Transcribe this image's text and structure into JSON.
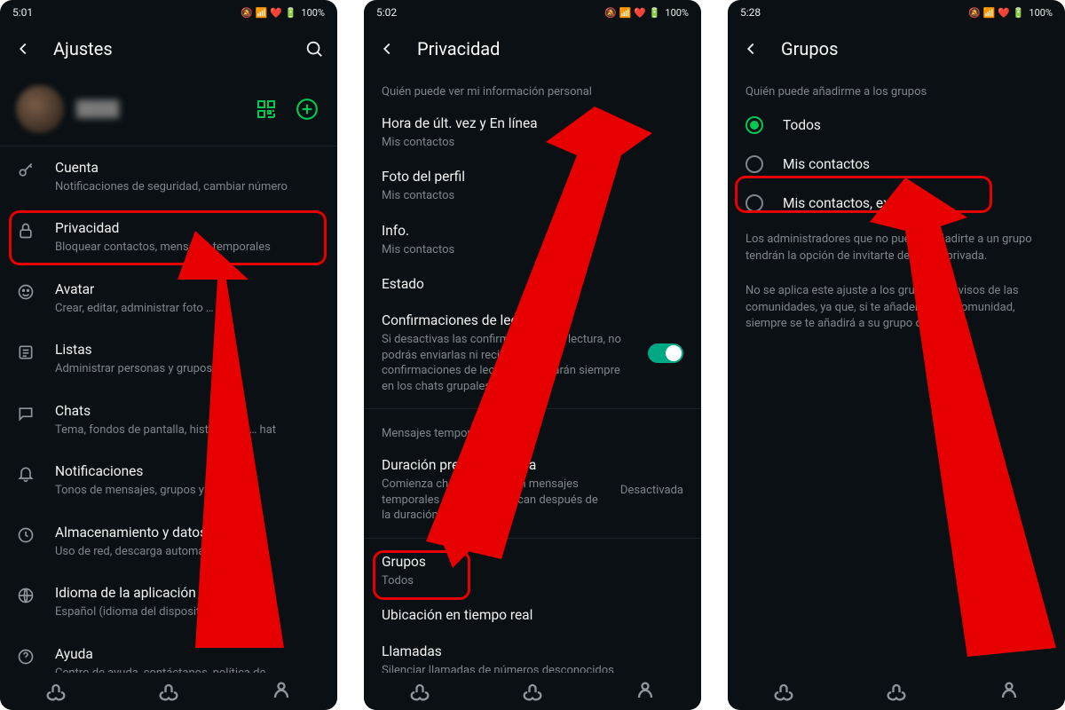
{
  "status": {
    "times": [
      "5:01",
      "5:02",
      "5:28"
    ],
    "battery": "100%",
    "icons": "🔕 📶 🔋"
  },
  "colors": {
    "accent": "#00c853",
    "toggle": "#00a884",
    "highlight": "#e60000",
    "bg": "#0a1014",
    "text": "#f2f2f2",
    "subtext": "#7e868c"
  },
  "screen1": {
    "title": "Ajustes",
    "settings": [
      {
        "icon": "key",
        "label": "Cuenta",
        "sub": "Notificaciones de seguridad, cambiar número"
      },
      {
        "icon": "lock",
        "label": "Privacidad",
        "sub": "Bloquear contactos, mensajes temporales"
      },
      {
        "icon": "face",
        "label": "Avatar",
        "sub": "Crear, editar, administrar foto … fil"
      },
      {
        "icon": "list",
        "label": "Listas",
        "sub": "Administrar personas y grupos"
      },
      {
        "icon": "chat",
        "label": "Chats",
        "sub": "Tema, fondos de pantalla, historial de … hat"
      },
      {
        "icon": "bell",
        "label": "Notificaciones",
        "sub": "Tonos de mensajes, grupos y llamadas"
      },
      {
        "icon": "data",
        "label": "Almacenamiento y datos",
        "sub": "Uso de red, descarga automática"
      },
      {
        "icon": "globe",
        "label": "Idioma de la aplicación",
        "sub": "Español (idioma del dispositivo)"
      },
      {
        "icon": "help",
        "label": "Ayuda",
        "sub": "Centro de ayuda, contáctanos, política de"
      }
    ]
  },
  "screen2": {
    "title": "Privacidad",
    "section1": "Quién puede ver mi información personal",
    "items1": [
      {
        "label": "Hora de últ. vez y En línea",
        "sub": "Mis contactos"
      },
      {
        "label": "Foto del perfil",
        "sub": "Mis contactos"
      },
      {
        "label": "Info.",
        "sub": "Mis contactos"
      },
      {
        "label": "Estado",
        "sub": ""
      }
    ],
    "readreceipts": {
      "label": "Confirmaciones de lectura",
      "sub": "Si desactivas las confirmaciones de lectura, no podrás enviarlas ni recibirlas. Las confirmaciones de lectura se enviarán siempre en los chats grupales."
    },
    "section2": "Mensajes temporales",
    "items2": [
      {
        "label": "Duración predeterminada",
        "sub": "Comienza chats nuevos con mensajes temporales que desaparezcan después de la duración que elijas.",
        "side": "Desactivada"
      }
    ],
    "items3": [
      {
        "label": "Grupos",
        "sub": "Todos"
      },
      {
        "label": "Ubicación en tiempo real",
        "sub": ""
      },
      {
        "label": "Llamadas",
        "sub": "Silenciar llamadas de números desconocidos"
      }
    ]
  },
  "screen3": {
    "title": "Grupos",
    "section": "Quién puede añadirme a los grupos",
    "options": [
      {
        "label": "Todos",
        "selected": true
      },
      {
        "label": "Mis contactos",
        "selected": false
      },
      {
        "label": "Mis contactos, excepto…",
        "selected": false
      }
    ],
    "desc1": "Los administradores que no puedan añadirte a un grupo tendrán la opción de invitarte de forma privada.",
    "desc2": "No se aplica este ajuste a los grupos de avisos de las comunidades, ya que, si te añaden a una comunidad, siempre se te añadirá a su grupo de avisos."
  }
}
